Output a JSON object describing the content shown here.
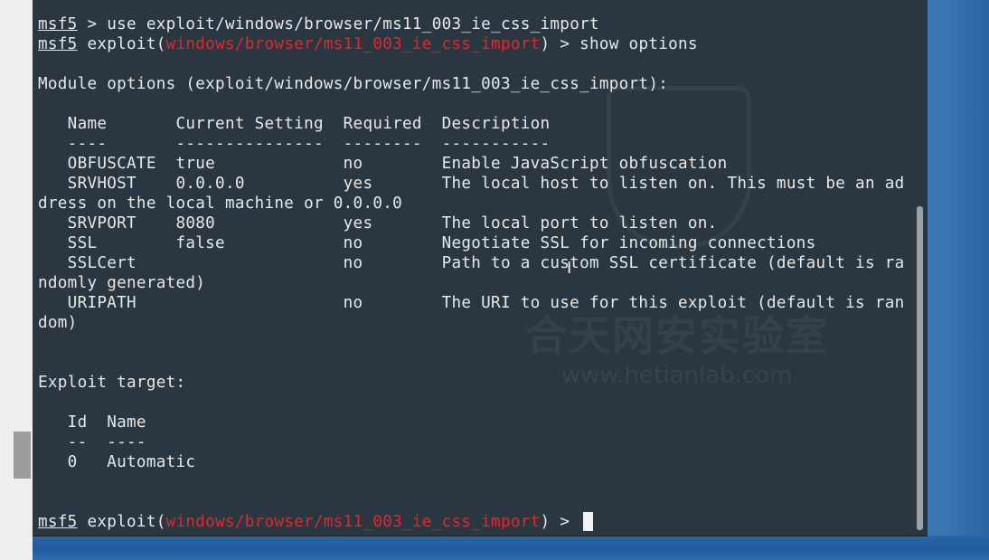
{
  "prompt": "msf5",
  "command_1": " > use exploit/windows/browser/ms11_003_ie_css_import",
  "exploit_prefix": " exploit(",
  "module_path": "windows/browser/ms11_003_ie_css_import",
  "command_2_suffix": ") > show options",
  "module_options_heading": "Module options (exploit/windows/browser/ms11_003_ie_css_import):",
  "options_header": "   Name       Current Setting  Required  Description",
  "options_rule": "   ----       ---------------  --------  -----------",
  "option_rows": [
    "   OBFUSCATE  true             no        Enable JavaScript obfuscation",
    "   SRVHOST    0.0.0.0          yes       The local host to listen on. This must be an ad",
    "dress on the local machine or 0.0.0.0",
    "   SRVPORT    8080             yes       The local port to listen on.",
    "   SSL        false            no        Negotiate SSL for incoming connections",
    "   SSLCert                     no        Path to a custom SSL certificate (default is ra",
    "ndomly generated)",
    "   URIPATH                     no        The URI to use for this exploit (default is ran",
    "dom)"
  ],
  "exploit_target_heading": "Exploit target:",
  "target_header": "   Id  Name",
  "target_rule": "   --  ----",
  "target_row": "   0   Automatic",
  "prompt_tail": ") > ",
  "watermark": {
    "cn": "合天网安实验室",
    "url": "www.hetianlab.com"
  },
  "colors": {
    "terminal_bg": "#2b3740",
    "text": "#e8e8e8",
    "module": "#e3262c",
    "desktop": "#2c6dab"
  },
  "icons": {
    "text_cursor": "text-cursor-icon"
  }
}
